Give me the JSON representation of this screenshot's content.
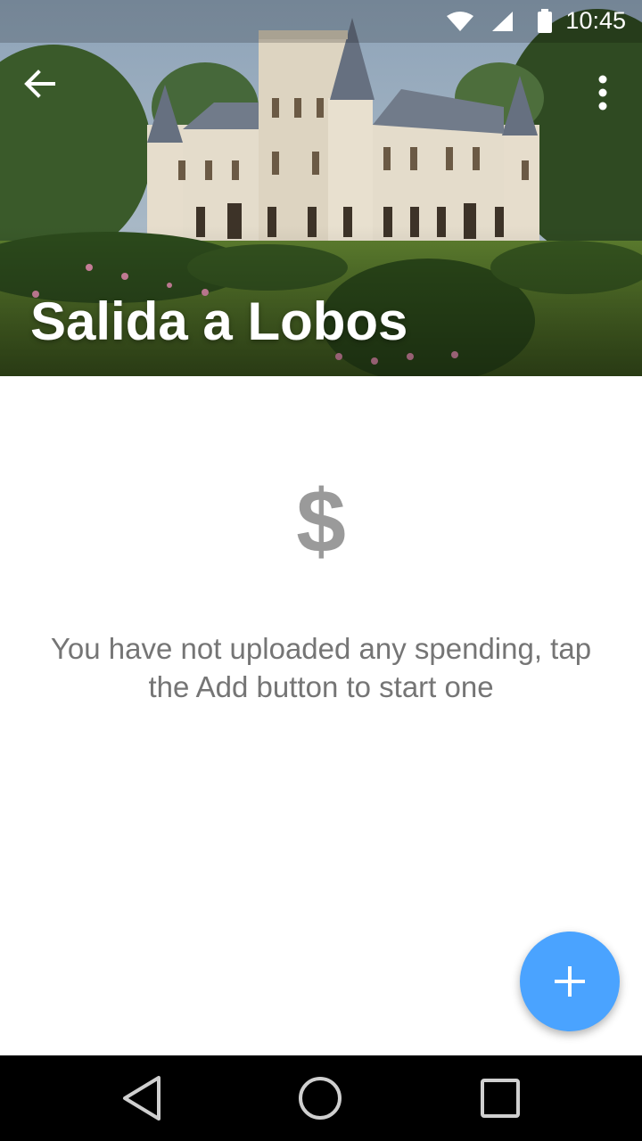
{
  "status_bar": {
    "time": "10:45",
    "icons": [
      "wifi-icon",
      "signal-icon",
      "battery-icon"
    ]
  },
  "header": {
    "title": "Salida a Lobos",
    "back_icon": "arrow-back-icon",
    "menu_icon": "more-vert-icon",
    "image": "castle-photo"
  },
  "empty_state": {
    "icon": "$",
    "message": "You have not uploaded any spending, tap the Add button to start one"
  },
  "fab": {
    "label": "+",
    "icon": "add-icon",
    "color": "#4aa3ff"
  },
  "nav_bar": {
    "icons": [
      "back-triangle-icon",
      "home-circle-icon",
      "recents-square-icon"
    ]
  }
}
